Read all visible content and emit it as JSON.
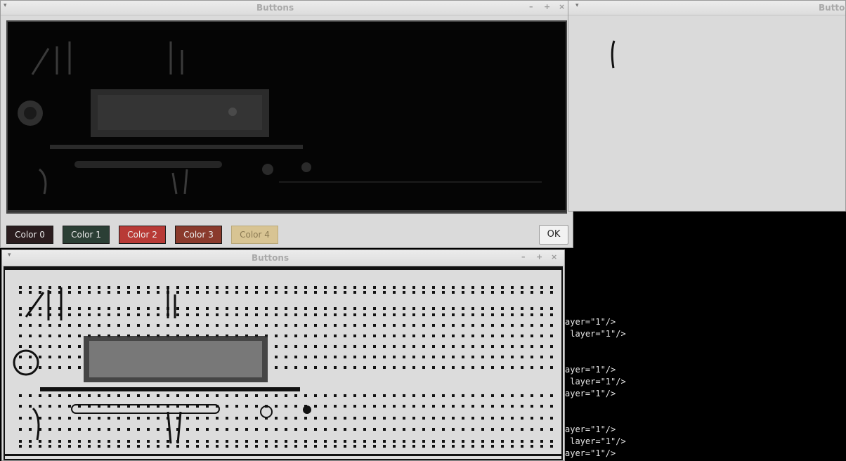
{
  "window_main": {
    "title": "Buttons",
    "menu_icon": "▾",
    "minimize_icon": "–",
    "maximize_icon": "+",
    "close_icon": "×",
    "buttons": [
      {
        "label": "Color 0",
        "bg": "#2a1c1e"
      },
      {
        "label": "Color 1",
        "bg": "#2b3f35"
      },
      {
        "label": "Color 2",
        "bg": "#b83a36"
      },
      {
        "label": "Color 3",
        "bg": "#8a3a2c"
      },
      {
        "label": "Color 4",
        "bg": "#d8c493"
      }
    ],
    "ok_label": "OK"
  },
  "window_right": {
    "title": "Button",
    "menu_icon": "▾"
  },
  "window_bottom": {
    "title": "Buttons",
    "menu_icon": "▾",
    "minimize_icon": "–",
    "maximize_icon": "+",
    "close_icon": "×"
  },
  "terminal": {
    "lines": [
      "ayer=\"1\"/>",
      " layer=\"1\"/>",
      "ayer=\"1\"/>",
      " layer=\"1\"/>",
      "ayer=\"1\"/>",
      "ayer=\"1\"/>",
      " layer=\"1\"/>",
      "ayer=\"1\"/>"
    ]
  }
}
